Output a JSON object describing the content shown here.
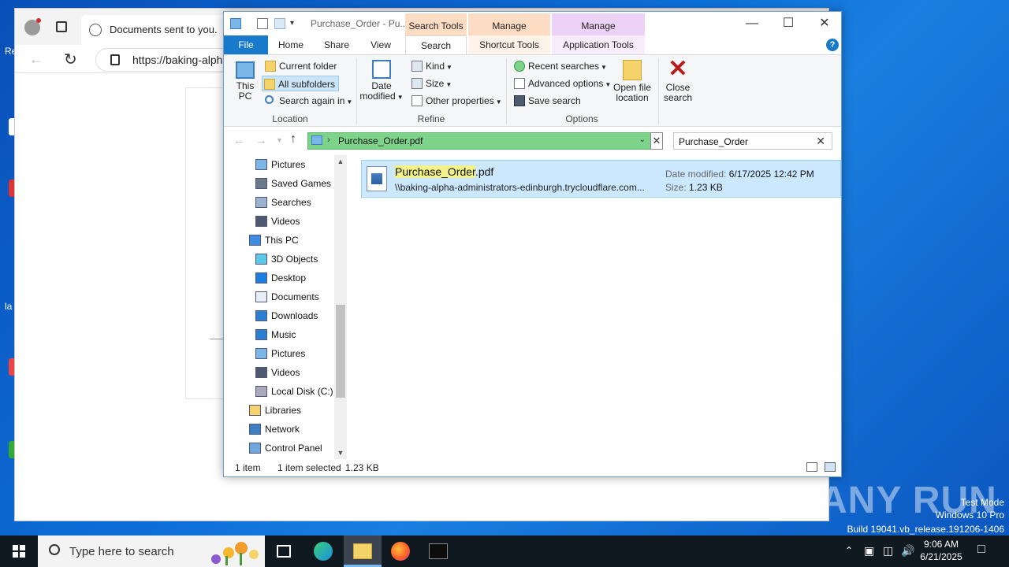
{
  "desktop": {
    "left_fragments": [
      "Re",
      "la"
    ],
    "watermark_logo": "ANY RUN",
    "watermark": [
      "Test Mode",
      "Windows 10 Pro",
      "Build 19041.vb_release.191206-1406"
    ]
  },
  "browser": {
    "tab_title": "Documents sent to you.",
    "url": "https://baking-alph"
  },
  "explorer": {
    "title": "Purchase_Order - Pu...",
    "context_headers": {
      "search_tools": "Search Tools",
      "manage_shortcut": "Manage",
      "manage_app": "Manage"
    },
    "tabs": {
      "file": "File",
      "home": "Home",
      "share": "Share",
      "view": "View",
      "search": "Search",
      "shortcut_tools": "Shortcut Tools",
      "application_tools": "Application Tools"
    },
    "ribbon": {
      "location": {
        "label": "Location",
        "this_pc": "This PC",
        "current_folder": "Current folder",
        "all_subfolders": "All subfolders",
        "search_again_in": "Search again in"
      },
      "refine": {
        "label": "Refine",
        "date_modified": "Date modified",
        "kind": "Kind",
        "size": "Size",
        "other_properties": "Other properties"
      },
      "options": {
        "label": "Options",
        "recent_searches": "Recent searches",
        "advanced_options": "Advanced options",
        "save_search": "Save search",
        "open_file_location": "Open file location"
      },
      "close_search": "Close search"
    },
    "address": {
      "path": "Purchase_Order.pdf"
    },
    "search": {
      "value": "Purchase_Order"
    },
    "nav_items": [
      {
        "label": "Pictures",
        "icon": "pictures-icon",
        "indent": 1
      },
      {
        "label": "Saved Games",
        "icon": "saved-games-icon",
        "indent": 1
      },
      {
        "label": "Searches",
        "icon": "searches-icon",
        "indent": 1
      },
      {
        "label": "Videos",
        "icon": "videos-icon",
        "indent": 1
      },
      {
        "label": "This PC",
        "icon": "this-pc-icon",
        "indent": 0
      },
      {
        "label": "3D Objects",
        "icon": "3d-objects-icon",
        "indent": 1
      },
      {
        "label": "Desktop",
        "icon": "desktop-icon",
        "indent": 1
      },
      {
        "label": "Documents",
        "icon": "documents-icon",
        "indent": 1
      },
      {
        "label": "Downloads",
        "icon": "downloads-icon",
        "indent": 1
      },
      {
        "label": "Music",
        "icon": "music-icon",
        "indent": 1
      },
      {
        "label": "Pictures",
        "icon": "pictures-icon",
        "indent": 1
      },
      {
        "label": "Videos",
        "icon": "videos-icon",
        "indent": 1
      },
      {
        "label": "Local Disk (C:)",
        "icon": "local-disk-icon",
        "indent": 1
      },
      {
        "label": "Libraries",
        "icon": "libraries-icon",
        "indent": 0
      },
      {
        "label": "Network",
        "icon": "network-icon",
        "indent": 0
      },
      {
        "label": "Control Panel",
        "icon": "control-panel-icon",
        "indent": 0
      }
    ],
    "result": {
      "name_highlight": "Purchase_Order",
      "name_rest": ".pdf",
      "path": "\\\\baking-alpha-administrators-edinburgh.trycloudflare.com...",
      "date_label": "Date modified:",
      "date_value": "6/17/2025 12:42 PM",
      "size_label": "Size:",
      "size_value": "1.23 KB"
    },
    "status": {
      "count": "1 item",
      "selected": "1 item selected",
      "size": "1.23 KB"
    }
  },
  "taskbar": {
    "search_placeholder": "Type here to search",
    "apps": [
      "task-view-icon",
      "edge-icon",
      "file-explorer-icon",
      "firefox-icon",
      "terminal-icon"
    ],
    "time": "9:06 AM",
    "date": "6/21/2025"
  },
  "colors": {
    "accent": "#1979ca",
    "selection": "#cce8ff",
    "path_bar": "#7ed38b",
    "search_tools_tab": "#fddcc4",
    "app_tools_tab": "#ecd2f7"
  }
}
